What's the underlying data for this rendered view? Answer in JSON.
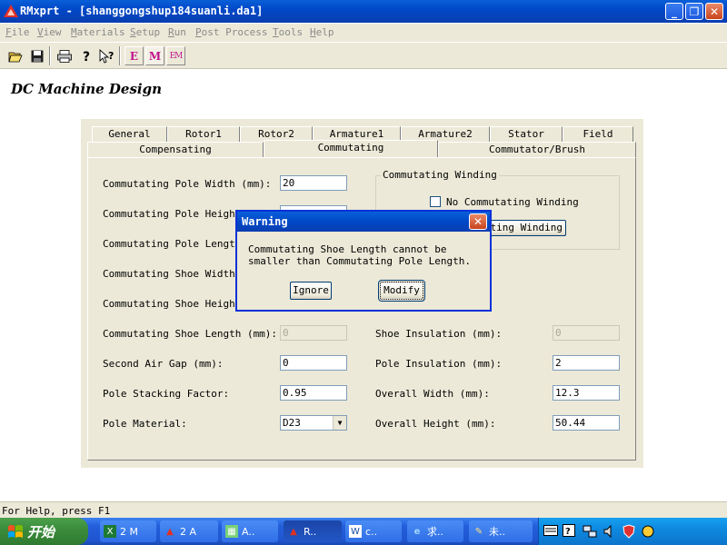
{
  "window": {
    "title": "RMxprt - [shanggongshup184suanli.da1]",
    "controls": {
      "minimize": "_",
      "maximize": "❐",
      "close": "✕"
    }
  },
  "menu": [
    {
      "key": "F",
      "rest": "ile"
    },
    {
      "key": "V",
      "rest": "iew"
    },
    {
      "key": "M",
      "rest": "aterials"
    },
    {
      "key": "S",
      "rest": "etup"
    },
    {
      "key": "R",
      "rest": "un"
    },
    {
      "key": "P",
      "rest": "ost Process"
    },
    {
      "key": "T",
      "rest": "ools"
    },
    {
      "key": "H",
      "rest": "elp"
    }
  ],
  "toolbar": {
    "e_label": "E",
    "m_label": "M",
    "em_label": "EM"
  },
  "page": {
    "heading": "DC Machine Design"
  },
  "tabs": {
    "row1": [
      "General",
      "Rotor1",
      "Rotor2",
      "Armature1",
      "Armature2",
      "Stator",
      "Field"
    ],
    "row2": [
      "Compensating",
      "Commutating",
      "Commutator/Brush"
    ],
    "active": "Commutating"
  },
  "form": {
    "left": [
      {
        "label": "Commutating Pole Width (mm):",
        "value": "20"
      },
      {
        "label": "Commutating Pole Height",
        "value": ""
      },
      {
        "label": "Commutating Pole Length",
        "value": ""
      },
      {
        "label": "Commutating Shoe Width (",
        "value": ""
      },
      {
        "label": "Commutating Shoe Height",
        "value": ""
      },
      {
        "label": "Commutating Shoe Length (mm):",
        "value": "0"
      },
      {
        "label": "Second Air Gap (mm):",
        "value": "0"
      },
      {
        "label": "Pole Stacking Factor:",
        "value": "0.95"
      },
      {
        "label": "Pole Material:",
        "value": "D23"
      }
    ],
    "right": [
      {
        "label": "Shoe Insulation (mm):",
        "value": "0"
      },
      {
        "label": "Pole Insulation (mm):",
        "value": "2"
      },
      {
        "label": "Overall Width (mm):",
        "value": "12.3"
      },
      {
        "label": "Overall Height (mm):",
        "value": "50.44"
      }
    ],
    "group": {
      "title": "Commutating Winding",
      "checkbox_label": "No Commutating Winding",
      "checkbox_checked": false,
      "button_label": "ating Winding"
    }
  },
  "dialog": {
    "title": "Warning",
    "message": "Commutating Shoe Length cannot be smaller than Commutating Pole Length.",
    "ignore_label": "Ignore",
    "modify_label": "Modify",
    "close": "✕"
  },
  "statusbar": {
    "text": "For Help, press F1"
  },
  "taskbar": {
    "start_label": "开始",
    "tasks": [
      "2 M",
      "2 A",
      "A..",
      "R..",
      "c..",
      "求..",
      "未.."
    ],
    "active_task": "R.."
  },
  "colors": {
    "titlebar": "#0048c8",
    "face": "#ece9d8",
    "taskbar": "#245edb",
    "start": "#3c8d3c"
  }
}
